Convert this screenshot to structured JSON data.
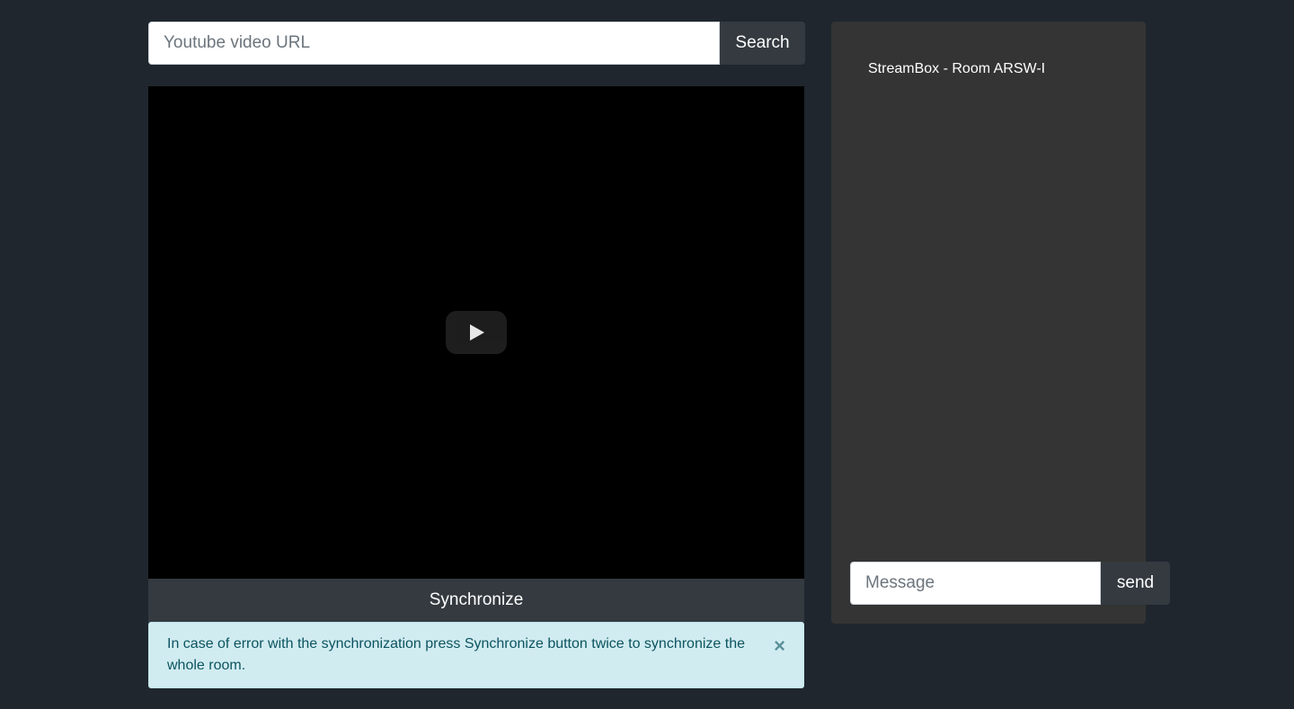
{
  "search": {
    "placeholder": "Youtube video URL",
    "value": "",
    "button_label": "Search"
  },
  "player": {
    "play_icon": "play-icon"
  },
  "sync": {
    "button_label": "Synchronize"
  },
  "alert": {
    "text": "In case of error with the synchronization press Synchronize button twice to synchronize the whole room.",
    "close_label": "×"
  },
  "chat": {
    "room_title": "StreamBox - Room ARSW-I",
    "message_placeholder": "Message",
    "message_value": "",
    "send_label": "send"
  },
  "colors": {
    "page_background": "#1f262e",
    "panel_background": "#343434",
    "button_background": "#343a40",
    "alert_background": "#d1ecf1",
    "alert_text": "#0c5460"
  }
}
